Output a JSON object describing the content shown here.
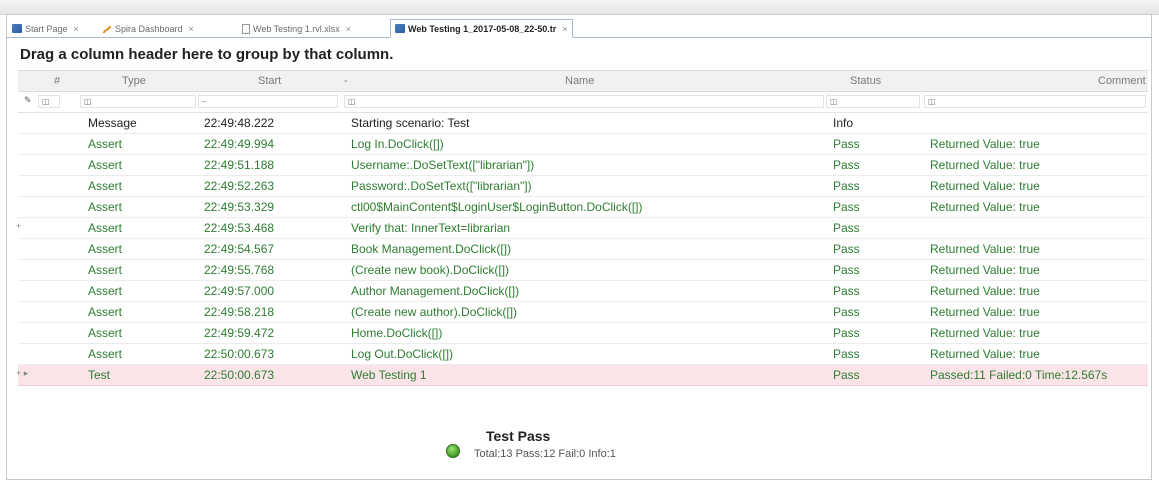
{
  "tabs": [
    {
      "label": "Start Page",
      "icon": "blue-window-icon"
    },
    {
      "label": "Spira Dashboard",
      "icon": "spira-icon"
    },
    {
      "label": "Web Testing 1.rvl.xlsx",
      "icon": "document-icon"
    },
    {
      "label": "Web Testing 1_2017-05-08_22-50.tr",
      "icon": "blue-window-icon",
      "active": true
    }
  ],
  "close_glyph": "×",
  "group_hint": "Drag a column header here to group by that column.",
  "columns": {
    "num": "#",
    "type": "Type",
    "start": "Start",
    "sort": "-",
    "name": "Name",
    "status": "Status",
    "comment": "Comment"
  },
  "filter_start_value": "–",
  "rows": [
    {
      "type": "Message",
      "start": "22:49:48.222",
      "name": "Starting scenario: Test",
      "status": "Info",
      "comment": ""
    },
    {
      "type": "Assert",
      "start": "22:49:49.994",
      "name": "Log In.DoClick([])",
      "status": "Pass",
      "comment": "Returned Value: true"
    },
    {
      "type": "Assert",
      "start": "22:49:51.188",
      "name": "Username:.DoSetText([\"librarian\"])",
      "status": "Pass",
      "comment": "Returned Value: true"
    },
    {
      "type": "Assert",
      "start": "22:49:52.263",
      "name": "Password:.DoSetText([\"librarian\"])",
      "status": "Pass",
      "comment": "Returned Value: true"
    },
    {
      "type": "Assert",
      "start": "22:49:53.329",
      "name": "ctl00$MainContent$LoginUser$LoginButton.DoClick([])",
      "status": "Pass",
      "comment": "Returned Value: true"
    },
    {
      "type": "Assert",
      "start": "22:49:53.468",
      "name": "Verify that: InnerText=librarian",
      "status": "Pass",
      "comment": ""
    },
    {
      "type": "Assert",
      "start": "22:49:54.567",
      "name": "Book Management.DoClick([])",
      "status": "Pass",
      "comment": "Returned Value: true"
    },
    {
      "type": "Assert",
      "start": "22:49:55.768",
      "name": "(Create new book).DoClick([])",
      "status": "Pass",
      "comment": "Returned Value: true"
    },
    {
      "type": "Assert",
      "start": "22:49:57.000",
      "name": "Author Management.DoClick([])",
      "status": "Pass",
      "comment": "Returned Value: true"
    },
    {
      "type": "Assert",
      "start": "22:49:58.218",
      "name": "(Create new author).DoClick([])",
      "status": "Pass",
      "comment": "Returned Value: true"
    },
    {
      "type": "Assert",
      "start": "22:49:59.472",
      "name": "Home.DoClick([])",
      "status": "Pass",
      "comment": "Returned Value: true"
    },
    {
      "type": "Assert",
      "start": "22:50:00.673",
      "name": "Log Out.DoClick([])",
      "status": "Pass",
      "comment": "Returned Value: true"
    },
    {
      "type": "Test",
      "start": "22:50:00.673",
      "name": "Web Testing 1",
      "status": "Pass",
      "comment": "Passed:11 Failed:0 Time:12.567s"
    }
  ],
  "summary": {
    "title": "Test Pass",
    "details": "Total:13 Pass:12 Fail:0 Info:1"
  },
  "colors": {
    "pass_text": "#2e7d32",
    "test_row_bg": "#fbe4e8",
    "status_ok": "#3f9a22"
  }
}
